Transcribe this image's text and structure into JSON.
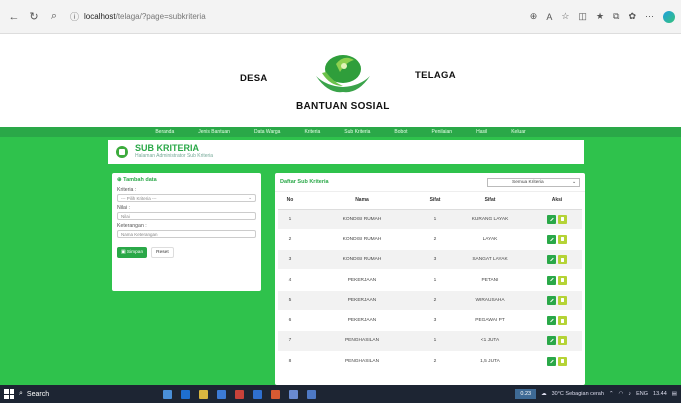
{
  "browser": {
    "url_host": "localhost",
    "url_path": "/telaga/?page=subkriteria"
  },
  "header": {
    "word_left": "DESA",
    "word_right": "TELAGA",
    "word_bottom": "BANTUAN SOSIAL"
  },
  "nav": [
    "Beranda",
    "Jenis Bantuan",
    "Data Warga",
    "Kriteria",
    "Sub Kriteria",
    "Bobot",
    "Penilaian",
    "Hasil",
    "Keluar"
  ],
  "page": {
    "title": "SUB KRITERIA",
    "subtitle": "Halaman Administrator Sub Kriteria"
  },
  "form": {
    "heading": "Tambah data",
    "kriteria_label": "Kriteria :",
    "kriteria_value": "--- Pilih Kriteria ---",
    "nilai_label": "Nilai :",
    "nilai_placeholder": "Nilai",
    "keterangan_label": "Keterangan :",
    "keterangan_placeholder": "Nama Keterangan",
    "save_label": "Simpan",
    "reset_label": "Reset"
  },
  "table": {
    "title": "Daftar Sub Kriteria",
    "filter_value": "Semua Kriteria",
    "headers": [
      "No",
      "Nama",
      "Sifat",
      "Sifat",
      "Aksi"
    ],
    "rows": [
      [
        "1",
        "KONDISI RUMAH",
        "1",
        "KURANG LAYAK"
      ],
      [
        "2",
        "KONDISI RUMAH",
        "2",
        "LAYAK"
      ],
      [
        "3",
        "KONDISI RUMAH",
        "3",
        "SANGAT LAYAK"
      ],
      [
        "4",
        "PEKERJAAN",
        "1",
        "PETANI"
      ],
      [
        "5",
        "PEKERJAAN",
        "2",
        "WIRAUSAHA"
      ],
      [
        "6",
        "PEKERJAAN",
        "3",
        "PEGAWAI PT"
      ],
      [
        "7",
        "PENGHASILAN",
        "1",
        "<1 JUTA"
      ],
      [
        "8",
        "PENGHASILAN",
        "2",
        "1,5 JUTA"
      ]
    ]
  },
  "taskbar": {
    "search_label": "Search",
    "weather": "30°C Sebagian cerah",
    "lang": "ENG",
    "time": "13.44",
    "pill": "0.23"
  },
  "colors": {
    "green_main": "#2fc24c",
    "green_dark": "#2aa848",
    "delete_lime": "#b5d336"
  }
}
